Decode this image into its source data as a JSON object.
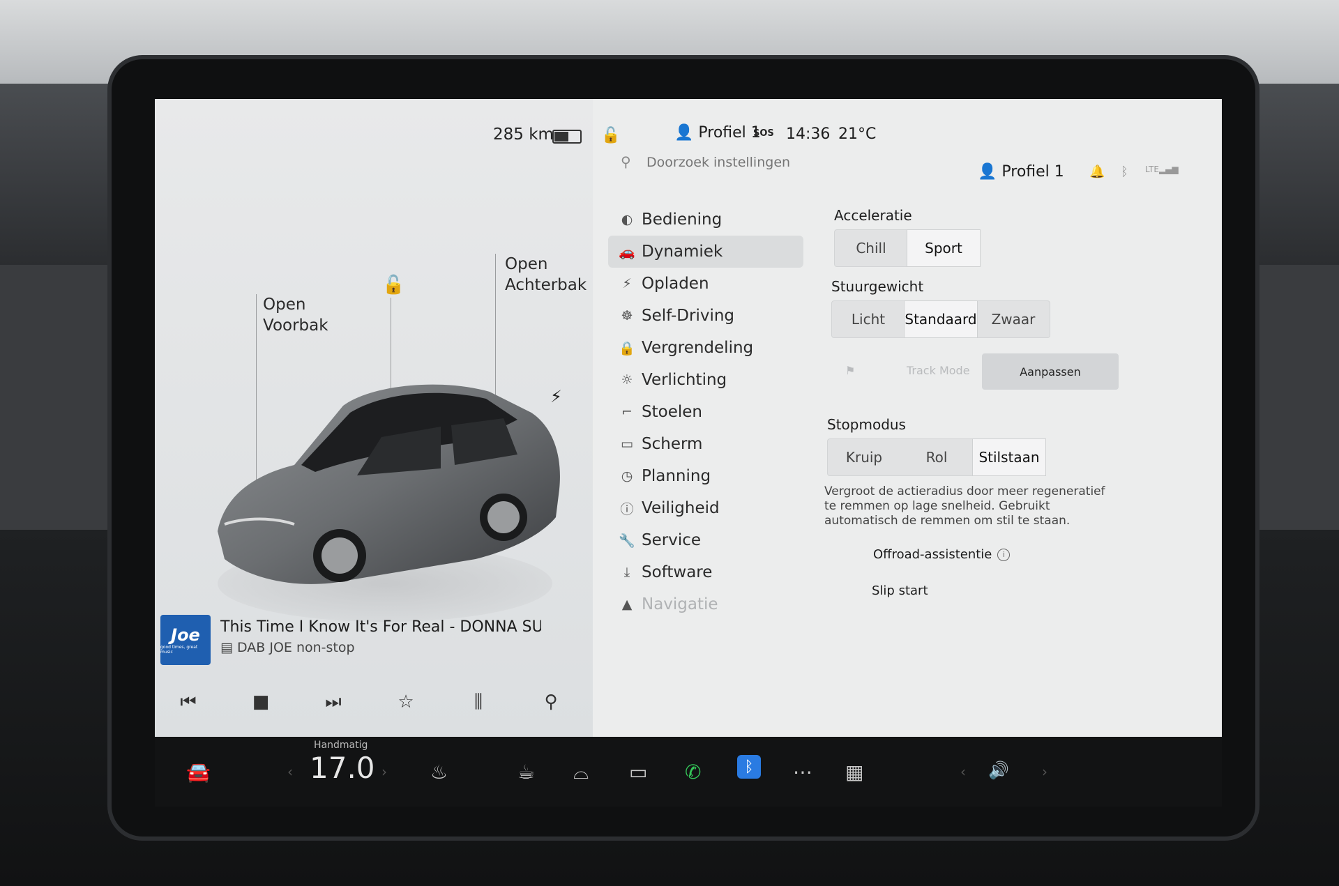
{
  "status": {
    "range": "285 km",
    "battery_pct": 0.55,
    "profile": "Profiel 1",
    "sos": "SOS",
    "time": "14:36",
    "temperature": "21°C"
  },
  "car": {
    "front_trunk": "Open\nVoorbak",
    "rear_trunk": "Open\nAchterbak"
  },
  "media": {
    "logo_text": "Joe",
    "logo_tagline": "good times, great music",
    "song": "This Time I Know It's For Real - DONNA SU",
    "station": "DAB JOE non-stop"
  },
  "search": {
    "placeholder": "Doorzoek instellingen"
  },
  "header": {
    "profile": "Profiel 1"
  },
  "nav": {
    "items": [
      {
        "label": "Bediening",
        "icon": "toggle-icon"
      },
      {
        "label": "Dynamiek",
        "icon": "car-icon"
      },
      {
        "label": "Opladen",
        "icon": "bolt-icon"
      },
      {
        "label": "Self-Driving",
        "icon": "steering-wheel-icon"
      },
      {
        "label": "Vergrendeling",
        "icon": "lock-icon"
      },
      {
        "label": "Verlichting",
        "icon": "sun-icon"
      },
      {
        "label": "Stoelen",
        "icon": "seat-icon"
      },
      {
        "label": "Scherm",
        "icon": "screen-icon"
      },
      {
        "label": "Planning",
        "icon": "clock-icon"
      },
      {
        "label": "Veiligheid",
        "icon": "info-icon"
      },
      {
        "label": "Service",
        "icon": "wrench-icon"
      },
      {
        "label": "Software",
        "icon": "download-icon"
      },
      {
        "label": "Navigatie",
        "icon": "navigation-icon"
      }
    ]
  },
  "settings": {
    "acceleratie": {
      "title": "Acceleratie",
      "options": [
        "Chill",
        "Sport"
      ],
      "selected": "Sport"
    },
    "stuurgewicht": {
      "title": "Stuurgewicht",
      "options": [
        "Licht",
        "Standaard",
        "Zwaar"
      ],
      "selected": "Standaard"
    },
    "track_mode": "Track Mode",
    "aanpassen": "Aanpassen",
    "stopmodus": {
      "title": "Stopmodus",
      "options": [
        "Kruip",
        "Rol",
        "Stilstaan"
      ],
      "selected": "Stilstaan",
      "description": "Vergroot de actieradius door meer regeneratief te remmen op lage snelheid. Gebruikt automatisch de remmen om stil te staan."
    },
    "offroad": "Offroad-assistentie",
    "slip_start": "Slip start"
  },
  "dock": {
    "temp_mode": "Handmatig",
    "temp_value": "17.0"
  }
}
